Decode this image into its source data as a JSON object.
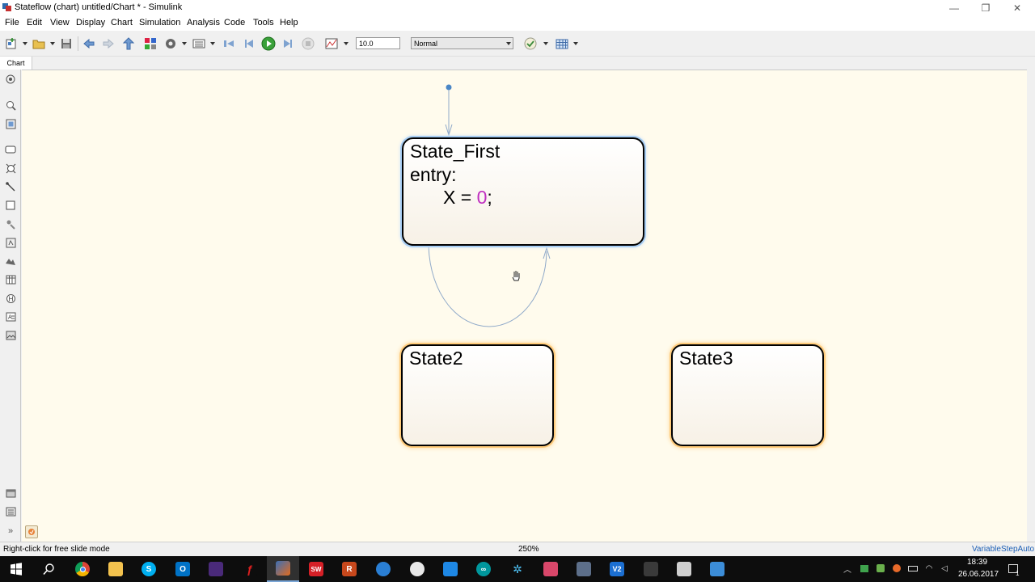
{
  "window": {
    "title": "Stateflow (chart) untitled/Chart * - Simulink",
    "minimize": "—",
    "restore": "❐",
    "close": "✕"
  },
  "menu": [
    "File",
    "Edit",
    "View",
    "Display",
    "Chart",
    "Simulation",
    "Analysis",
    "Code",
    "Tools",
    "Help"
  ],
  "toolbar": {
    "stop_time": "10.0",
    "sim_mode": "Normal"
  },
  "tab": {
    "label": "Chart"
  },
  "states": {
    "first": {
      "name": "State_First",
      "entry": "entry:",
      "action_lhs": "X = ",
      "action_num": "0",
      "action_end": ";"
    },
    "second": {
      "name": "State2"
    },
    "third": {
      "name": "State3"
    }
  },
  "status": {
    "hint": "Right-click for free slide mode",
    "zoom": "250%",
    "solver": "VariableStepAuto"
  },
  "taskbar": {
    "time": "18:39",
    "date": "26.06.2017",
    "notification_count": "1"
  },
  "colors": {
    "canvas": "#fffbed",
    "selected_glow": "#a6ccf2",
    "state_glow": "#ffcb7a",
    "number": "#c030c0",
    "transition": "#8fa9c9"
  }
}
